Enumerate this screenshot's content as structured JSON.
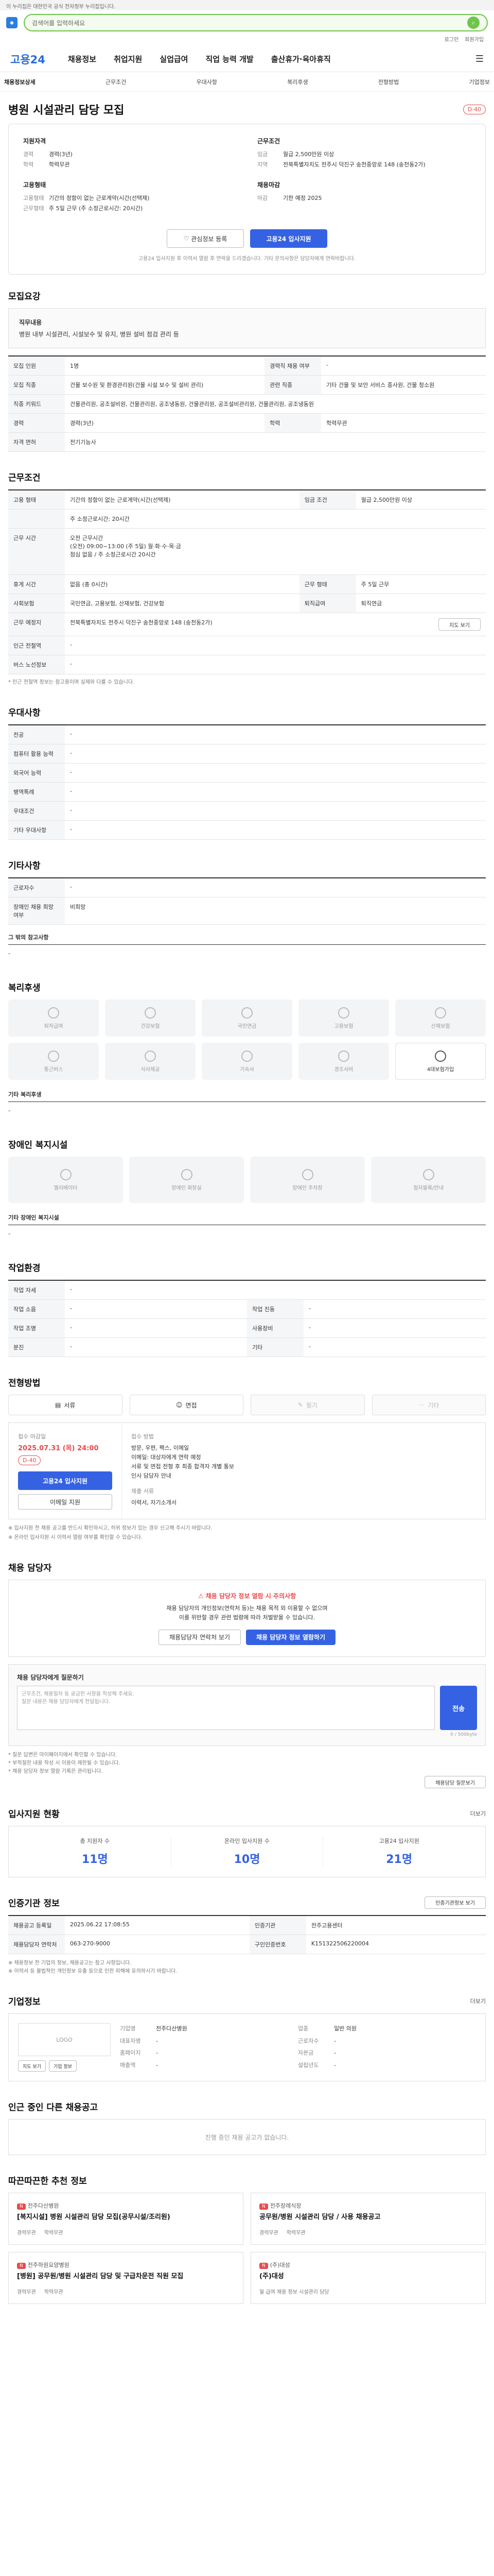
{
  "gov_banner": "이 누리집은 대한민국 공식 전자정부 누리집입니다.",
  "header": {
    "search_placeholder": "검색어를 입력하세요",
    "util_links": [
      "로그인",
      "회원가입"
    ],
    "brand": "고용24",
    "menu": [
      "채용정보",
      "취업지원",
      "실업급여",
      "직업 능력 개발",
      "출산휴가·육아휴직"
    ]
  },
  "breadcrumb": {
    "items": [
      "채용정보상세",
      "근무조건",
      "우대사항",
      "복리후생",
      "전형방법",
      "기업정보"
    ]
  },
  "job": {
    "title": "병원 시설관리 담당 모집",
    "dday": "D-40",
    "summary": {
      "left_title": "지원자격",
      "left_rows": [
        {
          "k": "경력",
          "v": "경력(3년)"
        },
        {
          "k": "학력",
          "v": "학력무관"
        }
      ],
      "right_title": "근무조건",
      "right_rows": [
        {
          "k": "임금",
          "v": "월급 2,500만원 이상"
        },
        {
          "k": "지역",
          "v": "전북특별자치도 전주시 덕진구 송천중앙로 148 (송천동2가)"
        }
      ],
      "left2_title": "고용형태",
      "left2_rows": [
        {
          "k": "고용형태",
          "v": "기간의 정함이 없는 근로계약(시간(선택제)"
        },
        {
          "k": "근무형태",
          "v": "주 5일 근무 (주 소정근로시간: 20시간)"
        }
      ],
      "right2_title": "채용마감",
      "right2_rows": [
        {
          "k": "마감",
          "v": "기한 예정 2025"
        }
      ]
    },
    "interest_btn": "관심정보 등록",
    "apply_btn": "고용24 입사지원",
    "note": "고용24 입사지원 후 이력서 열람 후 연락을 드리겠습니다. 기타 문의사항은 담당자에게 연락바랍니다."
  },
  "sections": {
    "recruit": {
      "title": "모집요강",
      "box_h": "직무내용",
      "box_t": "병원 내부 시설관리, 시설보수 및 유지, 병원 설비 점검 관리 등",
      "rows": [
        {
          "k": "모집 인원",
          "v": "1명",
          "k2": "경력직 채용 여부",
          "v2": "-"
        },
        {
          "k": "모집 직종",
          "v": "건물 보수원 및 환경관리원(건물 시설 보수 및 설비 관리)",
          "k2": "관련 직종",
          "v2": "기타 건물 및 보안 서비스 종사원, 건물 청소원"
        },
        {
          "k": "직종 키워드",
          "v": "건물관리원, 공조설비원, 건물관리원, 공조냉동원, 건물관리원, 공조설비관리원, 건물관리원, 공조냉동원",
          "k2": "",
          "v2": ""
        },
        {
          "k": "경력",
          "v": "경력(3년)",
          "k2": "학력",
          "v2": "학력무관"
        },
        {
          "k": "자격 면허",
          "v": "전기기능사",
          "k2": "",
          "v2": ""
        }
      ]
    },
    "condition": {
      "title": "근무조건",
      "rows": [
        {
          "k": "고용 형태",
          "v": "기간의 정함이 없는 근로계약(시간(선택제)",
          "k2": "임금 조건",
          "v2": "월급 2,500만원 이상"
        },
        {
          "k": "",
          "v": "주 소정근로시간: 20시간",
          "k2": "",
          "v2": ""
        },
        {
          "k": "근무 시간",
          "v": "오전 근무시간\n(오전) 09:00~13:00 (주 5일)  월·화·수·목·금\n점심 없음 / 주 소정근로시간 20시간",
          "k2": "",
          "v2": ""
        },
        {
          "k": "휴게 시간",
          "v": "없음 (총 0시간)",
          "k2": "근무 형태",
          "v2": "주 5일 근무"
        },
        {
          "k": "사회보험",
          "v": "국민연금, 고용보험, 산재보험, 건강보험",
          "k2": "퇴직급여",
          "v2": "퇴직연금"
        },
        {
          "k": "근무 예정지",
          "v": "전북특별자치도 전주시 덕진구 송천중앙로 148 (송천동2가)",
          "k2": "",
          "v2": ""
        },
        {
          "k": "인근 전철역",
          "v": "-",
          "k2": "",
          "v2": ""
        },
        {
          "k": "버스 노선정보",
          "v": "-",
          "k2": "",
          "v2": ""
        }
      ],
      "map_btn": "지도 보기",
      "note": "* 인근 전철역 정보는 참고용이며 실제와 다를 수 있습니다."
    },
    "prefer": {
      "title": "우대사항",
      "rows": [
        {
          "k": "전공",
          "v": "-"
        },
        {
          "k": "컴퓨터 활용 능력",
          "v": "-"
        },
        {
          "k": "외국어 능력",
          "v": "-"
        },
        {
          "k": "병역특례",
          "v": "-"
        },
        {
          "k": "우대조건",
          "v": "-"
        },
        {
          "k": "기타 우대사항",
          "v": "-"
        }
      ]
    },
    "etc": {
      "title": "기타사항",
      "rows": [
        {
          "k": "근로자수",
          "v": "-"
        },
        {
          "k": "장애인 채용 희망 여부",
          "v": "비희망"
        }
      ],
      "sub": "그 밖의 참고사항",
      "sub_v": "-"
    },
    "welfare": {
      "title": "복리후생",
      "tiles": [
        "퇴직급여",
        "건강보험",
        "국민연금",
        "고용보험",
        "산재보험",
        "통근버스",
        "식사제공",
        "기숙사",
        "경조사비",
        "4대보험가입"
      ],
      "on_index": 9,
      "sub": "기타 복리후생",
      "sub_v": "-"
    },
    "disabled": {
      "title": "장애인 복지시설",
      "tiles": [
        "엘리베이터",
        "장애인 화장실",
        "장애인 주차장",
        "점자블록/안내"
      ],
      "sub": "기타 장애인 복지시설",
      "sub_v": "-"
    },
    "workenv": {
      "title": "작업환경",
      "rows": [
        {
          "k": "작업 자세",
          "v": "-",
          "k2": "",
          "v2": ""
        },
        {
          "k": "작업 소음",
          "v": "-",
          "k2": "작업 진동",
          "v2": "-"
        },
        {
          "k": "작업 조명",
          "v": "-",
          "k2": "사용장비",
          "v2": "-"
        },
        {
          "k": "분진",
          "v": "-",
          "k2": "기타",
          "v2": "-"
        }
      ]
    },
    "process": {
      "title": "전형방법",
      "methods": [
        "서류",
        "면접",
        "필기",
        "기타"
      ],
      "active": [
        true,
        true,
        false,
        false
      ],
      "deadline_label": "접수 마감일",
      "deadline": "2025.07.31 (목) 24:00",
      "dday": "D-40",
      "apply_btn": "고용24 입사지원",
      "email_btn": "이메일 지원",
      "right_label": "접수 방법",
      "right_text": "방문, 우편, 팩스, 이메일\n이메일: 대상자에게 연락 예정\n서류 및 면접 전형 후 최종 합격자 개별 통보\n인사 담당자 안내",
      "right_label2": "제출 서류",
      "right_text2": "이력서, 자기소개서",
      "notes": [
        "※ 입사지원 전 채용 공고를 반드시 확인하시고, 허위 정보가 있는 경우 신고해 주시기 바랍니다.",
        "※ 온라인 입사지원 시 이력서 열람 여부를 확인할 수 있습니다."
      ]
    },
    "contact": {
      "title": "채용 담당자",
      "alert_title": "채용 담당자 정보 열람 시 주의사항",
      "alert_text": "채용 담당자의 개인정보(연락처 등)는 채용 목적 외 이용할 수 없으며\n이를 위반할 경우 관련 법령에 따라 처벌받을 수 있습니다.",
      "btn_a": "채용담당자 연락처 보기",
      "btn_b": "채용 담당자 정보 열람하기",
      "inq_title": "채용 담당자에게 질문하기",
      "inq_placeholder": "근무조건, 채용절차 등 궁금한 사항을 작성해 주세요.\n질문 내용은 채용 담당자에게 전달됩니다.",
      "inq_count": "0 / 500byte",
      "inq_btn": "전송",
      "inq_notes": [
        "* 질문 답변은 마이페이지에서 확인할 수 있습니다.",
        "* 부적절한 내용 작성 시 이용이 제한될 수 있습니다.",
        "* 채용 담당자 정보 열람 기록은 관리됩니다."
      ],
      "inq_link": "채용담당 질문보기"
    },
    "status": {
      "title": "입사지원 현황",
      "more": "더보기",
      "stats": [
        {
          "l": "총 지원자 수",
          "v": "11명"
        },
        {
          "l": "온라인 입사지원 수",
          "v": "10명"
        },
        {
          "l": "고용24 입사지원",
          "v": "21명"
        }
      ]
    },
    "agency": {
      "title": "인증기관 정보",
      "btn": "인증기관정보 보기",
      "rows": [
        {
          "k": "채용공고 등록일",
          "v": "2025.06.22 17:08:55",
          "k2": "인증기관",
          "v2": "전주고용센터"
        },
        {
          "k": "채용담당자 연락처",
          "v": "063-270-9000",
          "k2": "구인인증번호",
          "v2": "K151322506220004"
        }
      ],
      "notes": [
        "※ 채용정보 전 기업의 정보, 채용공고는 참고 사항입니다.",
        "※ 이력서 등 불법적인 개인정보 유출 등으로 인한 피해에 유의하시기 바랍니다."
      ]
    },
    "company": {
      "title": "기업정보",
      "more": "더보기",
      "logo": "LOGO",
      "rows": [
        {
          "k": "기업명",
          "v": "전주다산병원"
        },
        {
          "k": "업종",
          "v": "일반 의원"
        },
        {
          "k": "대표자명",
          "v": "-"
        },
        {
          "k": "근로자수",
          "v": "-"
        },
        {
          "k": "홈페이지",
          "v": "-"
        },
        {
          "k": "자본금",
          "v": "-"
        },
        {
          "k": "매출액",
          "v": "-"
        },
        {
          "k": "설립년도",
          "v": "-"
        }
      ],
      "btn_a": "지도 보기",
      "btn_b": "기업 정보"
    },
    "others": {
      "title": "인근 중인 다른 채용공고",
      "empty": "진행 중인 채용 공고가 없습니다."
    },
    "recommend": {
      "title": "따끈따끈한 추천 정보",
      "cards": [
        {
          "h": "전주다산병원",
          "t": "[복지시설] 병원 시설관리 담당 모집(공무시설/조리원)",
          "m": [
            "경력무관",
            "학력무관"
          ]
        },
        {
          "h": "전주장례식장",
          "t": "공무원/병원 시설관리 담당 / 사용 채용공고",
          "m": [
            "경력무관",
            "학력무관"
          ]
        },
        {
          "h": "전주하원요양병원",
          "t": "[병원] 공무원/병원 시설관리 담당 및 구급차운전 직원 모집",
          "m": [
            "경력무관",
            "학력무관"
          ]
        },
        {
          "h": "(주)대성",
          "t": "(주)대성",
          "m": [
            "월 급여 채용 정보 시설관리 담당"
          ]
        }
      ]
    }
  }
}
